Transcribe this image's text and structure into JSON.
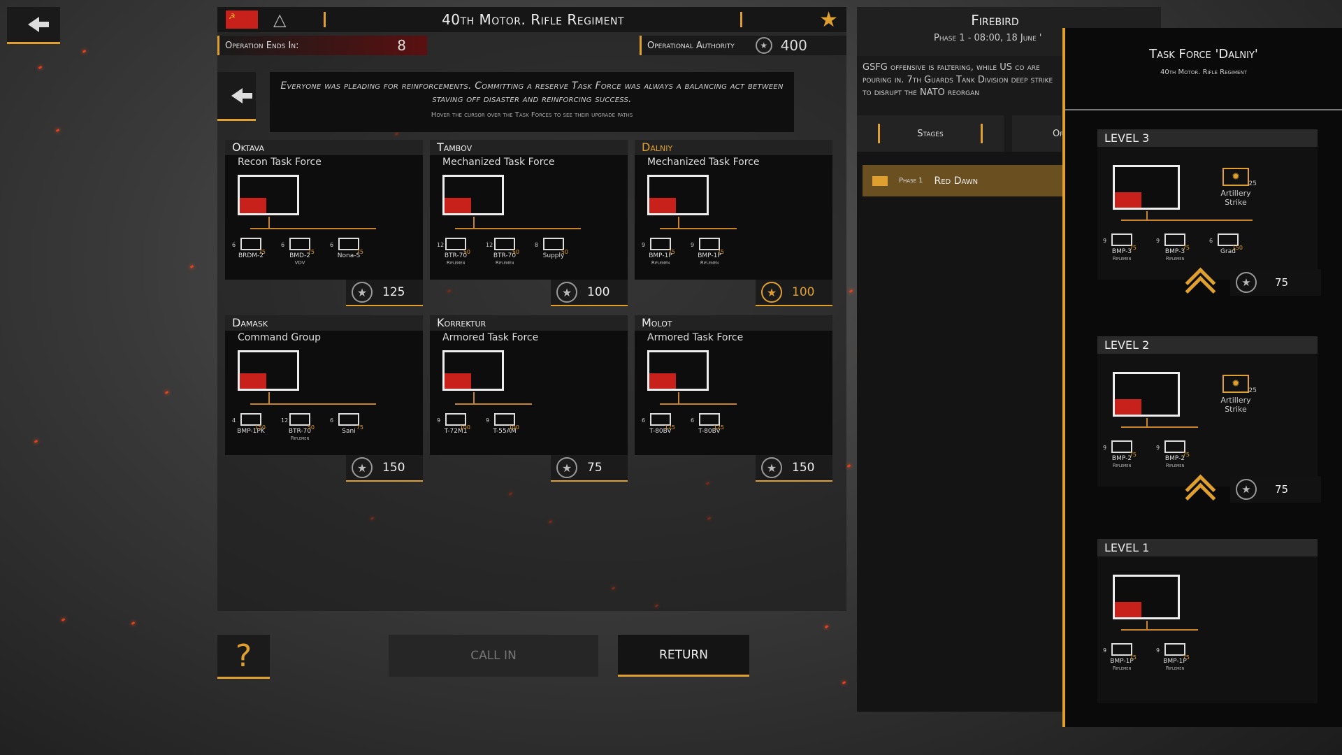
{
  "regiment": {
    "title": "40th Motor. Rifle Regiment",
    "operation_ends_label": "Operation Ends In:",
    "operation_ends_value": "8",
    "authority_label": "Operational Authority",
    "authority_value": "400"
  },
  "intro": {
    "text": "Everyone was pleading for reinforcements. Committing a reserve Task Force was always a balancing act between staving off disaster and reinforcing success.",
    "hint": "Hover the cursor over the Task Forces to see their upgrade paths"
  },
  "task_forces": [
    {
      "name": "Oktava",
      "type": "Recon Task Force",
      "cost": "125",
      "units": [
        {
          "count": "6",
          "name": "BRDM-2",
          "sub": "",
          "pts": "75"
        },
        {
          "count": "6",
          "name": "BMD-2",
          "sub": "VDV",
          "pts": "75"
        },
        {
          "count": "6",
          "name": "Nona-S",
          "sub": "",
          "pts": "75"
        }
      ]
    },
    {
      "name": "Tambov",
      "type": "Mechanized Task Force",
      "cost": "100",
      "units": [
        {
          "count": "12",
          "name": "BTR-70",
          "sub": "Riflemen",
          "pts": "50"
        },
        {
          "count": "12",
          "name": "BTR-70",
          "sub": "Riflemen",
          "pts": "50"
        },
        {
          "count": "8",
          "name": "Supply",
          "sub": "",
          "pts": "50"
        }
      ]
    },
    {
      "name": "Dalniy",
      "type": "Mechanized Task Force",
      "cost": "100",
      "units": [
        {
          "count": "9",
          "name": "BMP-1P",
          "sub": "Riflemen",
          "pts": "75"
        },
        {
          "count": "9",
          "name": "BMP-1P",
          "sub": "Riflemen",
          "pts": "75"
        }
      ]
    },
    {
      "name": "Damask",
      "type": "Command Group",
      "cost": "150",
      "units": [
        {
          "count": "4",
          "name": "BMP-1PK",
          "sub": "",
          "pts": "150"
        },
        {
          "count": "12",
          "name": "BTR-70",
          "sub": "Riflemen",
          "pts": "50"
        },
        {
          "count": "6",
          "name": "Sani",
          "sub": "",
          "pts": "75"
        }
      ]
    },
    {
      "name": "Korrektur",
      "type": "Armored Task Force",
      "cost": "75",
      "units": [
        {
          "count": "9",
          "name": "T-72M1",
          "sub": "",
          "pts": "100"
        },
        {
          "count": "9",
          "name": "T-55AM",
          "sub": "",
          "pts": "100"
        }
      ]
    },
    {
      "name": "Molot",
      "type": "Armored Task Force",
      "cost": "150",
      "units": [
        {
          "count": "6",
          "name": "T-80BV",
          "sub": "",
          "pts": "125"
        },
        {
          "count": "6",
          "name": "T-80BV",
          "sub": "",
          "pts": "125"
        }
      ]
    }
  ],
  "buttons": {
    "help": "?",
    "call_in": "CALL IN",
    "return": "RETURN"
  },
  "operation": {
    "title": "Firebird",
    "phase_line": "Phase 1 - 08:00, 18 June '",
    "description": "GSFG offensive is faltering, while US co are pouring in. 7th Guards Tank Division deep strike to disrupt the NATO reorgan",
    "tab_stages": "Stages",
    "tab_other": "Or",
    "phase_label": "Phase 1",
    "phase_name": "Red Dawn"
  },
  "tf_detail": {
    "title": "Task Force 'Dalniy'",
    "subtitle": "40th Motor. Rifle Regiment",
    "levels": [
      {
        "label": "LEVEL 3",
        "support_name": "Artillery Strike",
        "support_pts": "25",
        "upgrade_cost": "75",
        "units": [
          {
            "count": "9",
            "name": "BMP-3",
            "sub": "Riflemen",
            "pts": "75"
          },
          {
            "count": "9",
            "name": "BMP-3",
            "sub": "Riflemen",
            "pts": "75"
          },
          {
            "count": "6",
            "name": "Grad",
            "sub": "",
            "pts": "150"
          }
        ]
      },
      {
        "label": "LEVEL 2",
        "support_name": "Artillery Strike",
        "support_pts": "25",
        "upgrade_cost": "75",
        "units": [
          {
            "count": "9",
            "name": "BMP-2",
            "sub": "Riflemen",
            "pts": "75"
          },
          {
            "count": "9",
            "name": "BMP-2",
            "sub": "Riflemen",
            "pts": "75"
          }
        ]
      },
      {
        "label": "LEVEL 1",
        "units": [
          {
            "count": "9",
            "name": "BMP-1P",
            "sub": "Riflemen",
            "pts": "75"
          },
          {
            "count": "9",
            "name": "BMP-1P",
            "sub": "Riflemen",
            "pts": "75"
          }
        ]
      }
    ]
  },
  "icons": {
    "back": "back-arrow-icon",
    "star": "star-icon",
    "cost": "laurel-star-icon",
    "upgrade": "double-chevron-up-icon",
    "support": "artillery-icon"
  },
  "colors": {
    "accent": "#e0a030",
    "flag_red": "#c8201a",
    "panel": "#0d0d0d"
  }
}
